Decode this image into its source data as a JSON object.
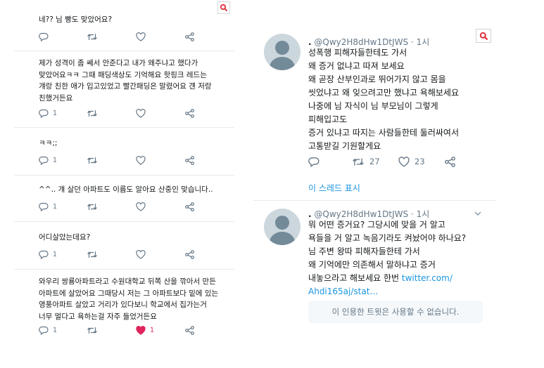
{
  "left": {
    "tweets": [
      {
        "text": "네?? 님 빵도 맞았어요?",
        "reply_count": "",
        "retweet_count": "",
        "like_count": ""
      },
      {
        "text": "제가 성격이 좀 쎄서 안준다고 내가 왜주냐고 했다가\n맞았어요ㅋㅋ 그때 패딩색상도 기억해요 핫핑크 레드는\n걔랑 친한 애가 입고있었고 빨간패딩은 말렸어요 걘 저랑\n친했거든요",
        "reply_count": "1",
        "retweet_count": "",
        "like_count": ""
      },
      {
        "text": "ㅋㅋ;;",
        "reply_count": "1",
        "retweet_count": "",
        "like_count": ""
      },
      {
        "text": "^^.. 걔 살던 아파트도 이름도 알아요 산중인 맞습니다..",
        "reply_count": "1",
        "retweet_count": "",
        "like_count": ""
      },
      {
        "text": "어디살았는데요?",
        "reply_count": "1",
        "retweet_count": "",
        "like_count": ""
      },
      {
        "text": "와우리 쌍룡아파트라고 수원대학교 뒤쪽 산을 깎아서 만든\n아파트에 살았어요 그때당시 저는 그 아파트보다 밑에 있는\n영풍아파트 살았고 거리가 있다보니 학교에서 집가는거\n너무 멀다고 욕하는걸 자주 들었거든요",
        "reply_count": "1",
        "retweet_count": "",
        "like_count": "1"
      }
    ]
  },
  "right": {
    "tweet1": {
      "name": ".",
      "handle": "@Qwy2H8dHw1DtJWS",
      "time": "· 1시",
      "text": "성폭행 피해자들한테도 가서\n왜 증거 없냐고 따져 보세요\n왜 곧장 산부인과로 뛰어가지 않고 몸을\n씻었냐고 왜 잊으려고만 했냐고 욕해보세요\n나중에 님 자식이 님 부모님이 그렇게\n피해입고도\n증거 있냐고 따지는 사람들한테 둘러싸여서\n고통받길 기원할게요",
      "reply_count": "",
      "retweet_count": "27",
      "like_count": "23",
      "thread_link": "이 스레드 표시"
    },
    "tweet2": {
      "name": ".",
      "handle": "@Qwy2H8dHw1DtJWS",
      "time": "· 1시",
      "text_lines": [
        "뭐 어떤 증거요? 그당시에 맞을 거 알고",
        "욕들을 거 알고 녹음기라도 켜놨어야 하나요?",
        "님 주변 왕따 피해자들한테 가서",
        "왜 기억에만 의존해서 말하냐고 증거",
        "내놓으라고 해보세요 한번"
      ],
      "link_inline": "twitter.com/",
      "link_line": "Ahdi165aj/stat…",
      "unavailable": "이 인용한 트윗은 사용할 수 없습니다."
    }
  },
  "colors": {
    "accent": "#1b95e0",
    "like": "#e0245e",
    "muted": "#657786"
  },
  "icons": [
    "reply-icon",
    "retweet-icon",
    "like-icon",
    "share-icon",
    "search-icon",
    "chevron-down-icon",
    "default-avatar-icon"
  ]
}
